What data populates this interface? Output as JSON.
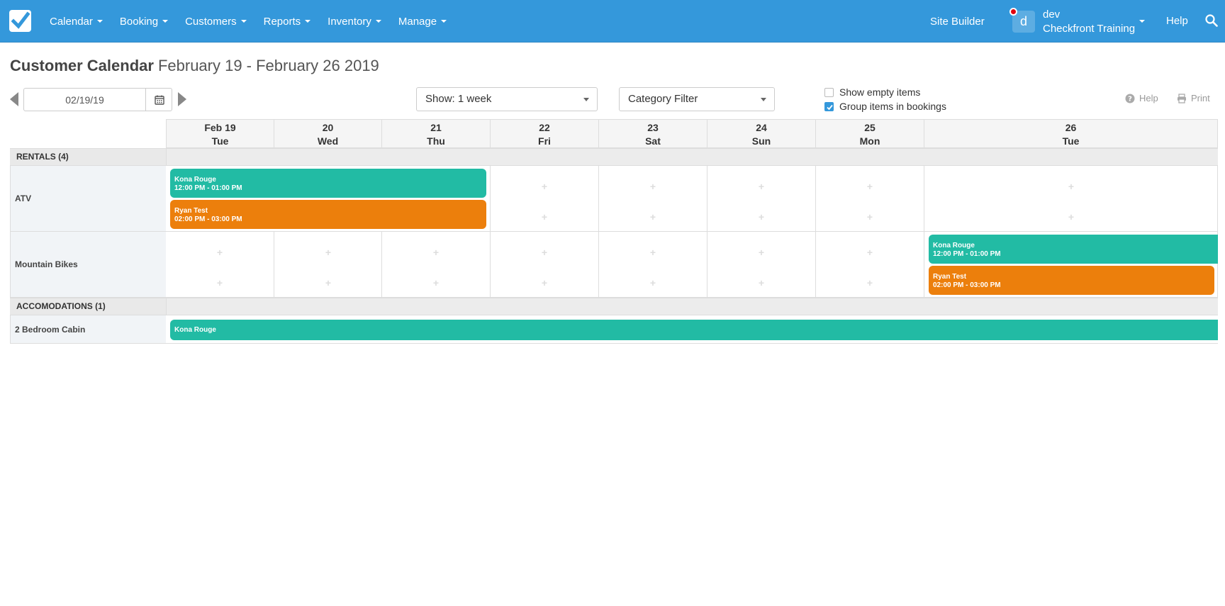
{
  "nav": {
    "menu": [
      {
        "label": "Calendar"
      },
      {
        "label": "Booking"
      },
      {
        "label": "Customers"
      },
      {
        "label": "Reports"
      },
      {
        "label": "Inventory"
      },
      {
        "label": "Manage"
      }
    ],
    "site_builder": "Site Builder",
    "avatar_letter": "d",
    "user_name": "dev",
    "account_name": "Checkfront Training",
    "help": "Help"
  },
  "page": {
    "title": "Customer Calendar",
    "date_range": "February 19 - February 26 2019"
  },
  "toolbar": {
    "date_value": "02/19/19",
    "show_select": "Show: 1 week",
    "category_filter": "Category Filter",
    "show_empty_label": "Show empty items",
    "show_empty_checked": false,
    "group_items_label": "Group items in bookings",
    "group_items_checked": true,
    "help_label": "Help",
    "print_label": "Print"
  },
  "calendar": {
    "days": [
      {
        "date": "Feb 19",
        "weekday": "Tue"
      },
      {
        "date": "20",
        "weekday": "Wed"
      },
      {
        "date": "21",
        "weekday": "Thu"
      },
      {
        "date": "22",
        "weekday": "Fri"
      },
      {
        "date": "23",
        "weekday": "Sat"
      },
      {
        "date": "24",
        "weekday": "Sun"
      },
      {
        "date": "25",
        "weekday": "Mon"
      },
      {
        "date": "26",
        "weekday": "Tue"
      }
    ],
    "categories": [
      {
        "label": "RENTALS (4)",
        "items": [
          {
            "name": "ATV",
            "bookings": [
              {
                "customer": "Kona Rouge",
                "time": "12:00 PM - 01:00 PM",
                "color": "#22bba4"
              },
              {
                "customer": "Ryan Test",
                "time": "02:00 PM - 03:00 PM",
                "color": "#ec7f0c"
              }
            ]
          },
          {
            "name": "Mountain Bikes",
            "bookings": [
              {
                "customer": "Kona Rouge",
                "time": "12:00 PM - 01:00 PM",
                "color": "#22bba4"
              },
              {
                "customer": "Ryan Test",
                "time": "02:00 PM - 03:00 PM",
                "color": "#ec7f0c"
              }
            ]
          }
        ]
      },
      {
        "label": "ACCOMODATIONS (1)",
        "items": [
          {
            "name": "2 Bedroom Cabin",
            "bookings": [
              {
                "customer": "Kona Rouge",
                "color": "#22bba4"
              }
            ]
          }
        ]
      }
    ]
  },
  "colors": {
    "nav_bg": "#3498db",
    "booking_teal": "#22bba4",
    "booking_orange": "#ec7f0c",
    "notification_dot": "#e3000f"
  }
}
